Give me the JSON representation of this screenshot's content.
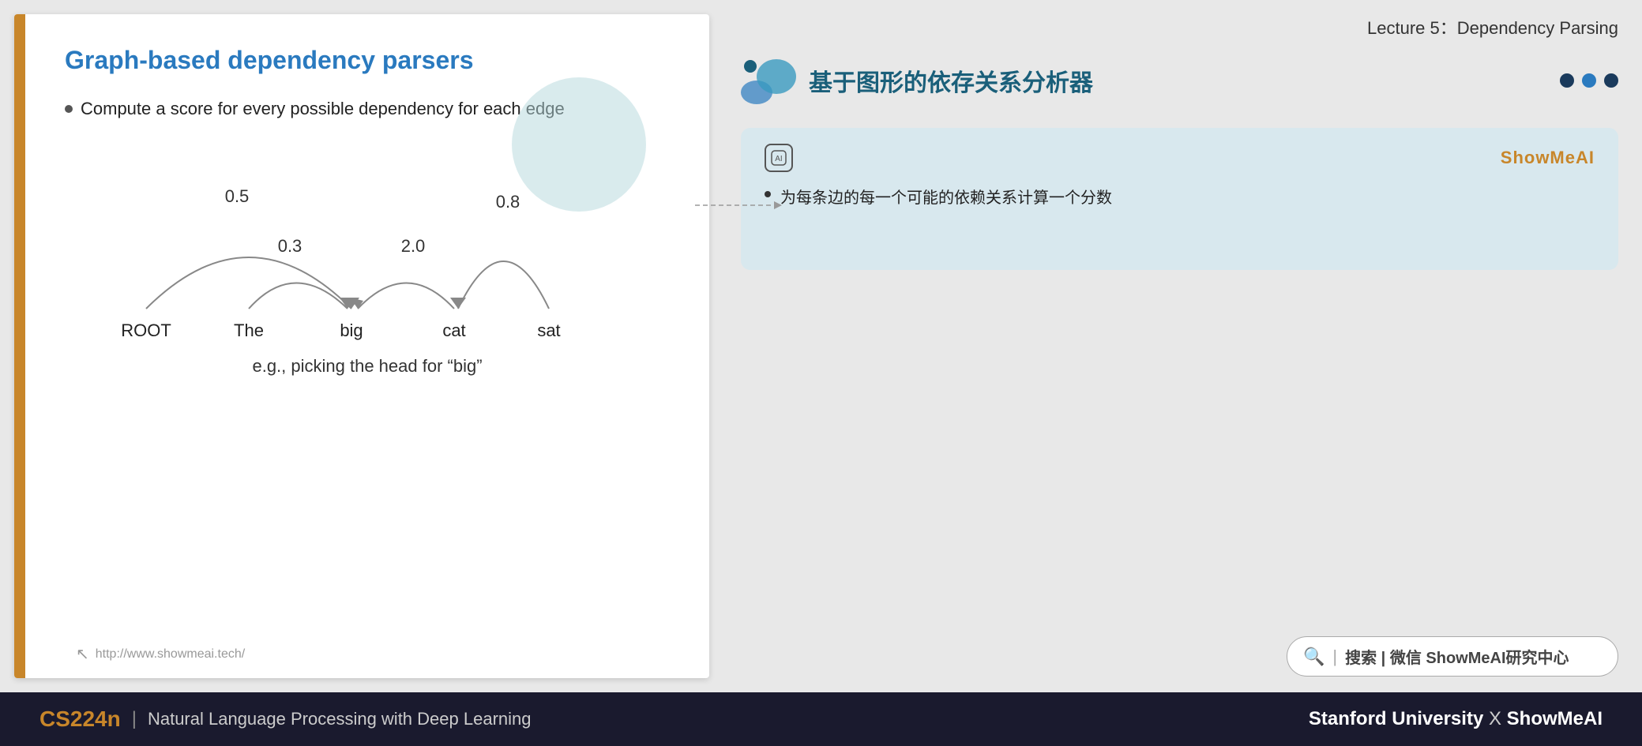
{
  "slide": {
    "title": "Graph-based dependency parsers",
    "bullet": "Compute a score for every possible dependency for each edge",
    "graph": {
      "words": [
        "ROOT",
        "The",
        "big",
        "cat",
        "sat"
      ],
      "arcs": [
        {
          "from": 0,
          "to": 2,
          "label": "0.5"
        },
        {
          "from": 1,
          "to": 2,
          "label": "0.3"
        },
        {
          "from": 3,
          "to": 2,
          "label": "2.0"
        },
        {
          "from": 4,
          "to": 3,
          "label": "0.8"
        }
      ],
      "example_text": "e.g., picking the head for “big”"
    },
    "footer_url": "http://www.showmeai.tech/"
  },
  "right_panel": {
    "lecture_title": "Lecture 5：Dependency Parsing",
    "card_title": "基于图形的依存关系分析器",
    "nav_dots": [
      "inactive",
      "active",
      "inactive"
    ],
    "translation_box": {
      "brand": "ShowMeAI",
      "bullet": "为每条边的每一个可能的依赖关系计算一个分数"
    },
    "search": {
      "icon": "🔍",
      "label": "搜索 | 微信 ShowMeAI研究中心"
    }
  },
  "bottom_bar": {
    "course_code": "CS224n",
    "divider": "|",
    "course_desc": "Natural Language Processing with Deep Learning",
    "right_text": "Stanford University",
    "right_x": "X",
    "right_brand": "ShowMeAI"
  }
}
